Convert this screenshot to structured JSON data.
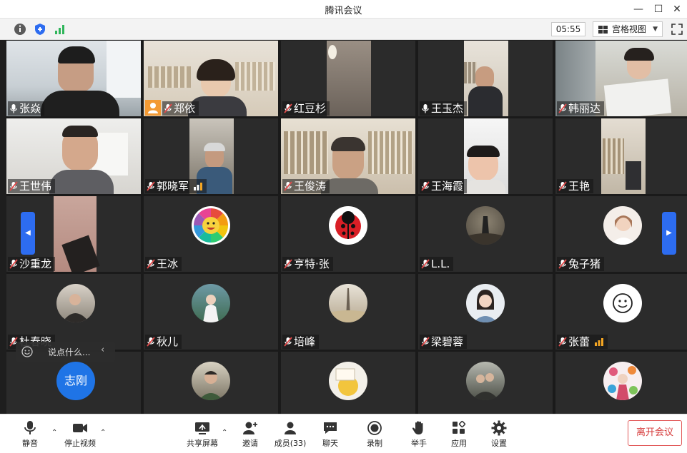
{
  "window": {
    "title": "腾讯会议"
  },
  "toolbar": {
    "timer": "05:55",
    "view_label": "宫格视图"
  },
  "participants": [
    {
      "name": "张焱",
      "muted": false
    },
    {
      "name": "郑依",
      "muted": true
    },
    {
      "name": "红豆杉",
      "muted": true
    },
    {
      "name": "王玉杰",
      "muted": false
    },
    {
      "name": "韩丽达",
      "muted": true
    },
    {
      "name": "王世伟",
      "muted": true
    },
    {
      "name": "郭晓军",
      "muted": true
    },
    {
      "name": "王俊涛",
      "muted": true
    },
    {
      "name": "王海霞",
      "muted": true
    },
    {
      "name": "王艳",
      "muted": true
    },
    {
      "name": "沙重龙",
      "muted": true
    },
    {
      "name": "王冰",
      "muted": true
    },
    {
      "name": "亨特·张",
      "muted": true
    },
    {
      "name": "L.L.",
      "muted": true
    },
    {
      "name": "兔子猪",
      "muted": true
    },
    {
      "name": "杜春晓",
      "muted": true
    },
    {
      "name": "秋儿",
      "muted": true
    },
    {
      "name": "培峰",
      "muted": true
    },
    {
      "name": "梁碧蓉",
      "muted": true
    },
    {
      "name": "张蕾",
      "muted": true
    },
    {
      "name": "志刚",
      "avatar_text": "志刚"
    }
  ],
  "chat": {
    "placeholder": "说点什么..."
  },
  "bottombar": {
    "mute": "静音",
    "stop_video": "停止视频",
    "share_screen": "共享屏幕",
    "invite": "邀请",
    "members": "成员(33)",
    "chat": "聊天",
    "record": "录制",
    "raise_hand": "举手",
    "apps": "应用",
    "settings": "设置",
    "leave": "离开会议"
  },
  "colors": {
    "accent_blue": "#2d6cf0",
    "active_border": "#3fbf5a",
    "leave_red": "#d63b3b",
    "mic_red": "#e04b4b"
  }
}
